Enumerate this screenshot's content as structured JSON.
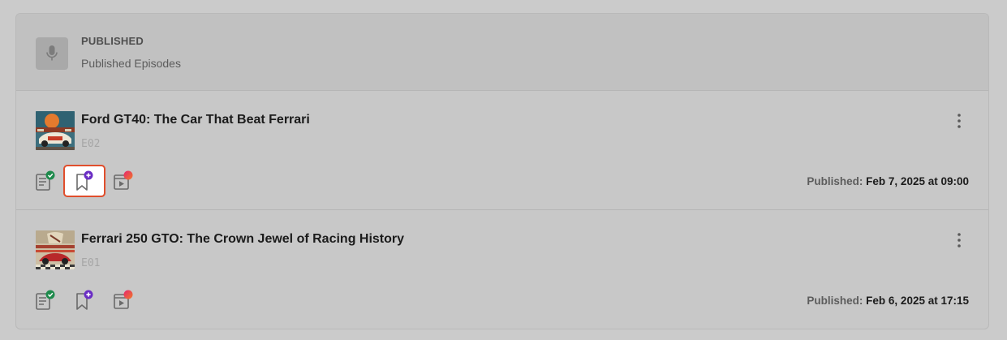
{
  "header": {
    "title": "PUBLISHED",
    "subtitle": "Published Episodes",
    "icon": "microphone-icon"
  },
  "episodes": [
    {
      "title": "Ford GT40: The Car That Beat Ferrari",
      "number": "E02",
      "published_label": "Published:",
      "published_value": "Feb 7, 2025 at 09:00",
      "actions": [
        "transcript-done-icon",
        "bookmark-add-icon",
        "media-badge-icon"
      ],
      "highlighted_action": "bookmark-add-icon"
    },
    {
      "title": "Ferrari 250 GTO: The Crown Jewel of Racing History",
      "number": "E01",
      "published_label": "Published:",
      "published_value": "Feb 6, 2025 at 17:15",
      "actions": [
        "transcript-done-icon",
        "bookmark-add-icon",
        "media-badge-icon"
      ]
    }
  ],
  "colors": {
    "check_green": "#1e8a4c",
    "plus_purple": "#6a2dc4",
    "highlight_border": "#e04e2c",
    "badge_gradient": [
      "#e6236f",
      "#f07d2a"
    ]
  }
}
